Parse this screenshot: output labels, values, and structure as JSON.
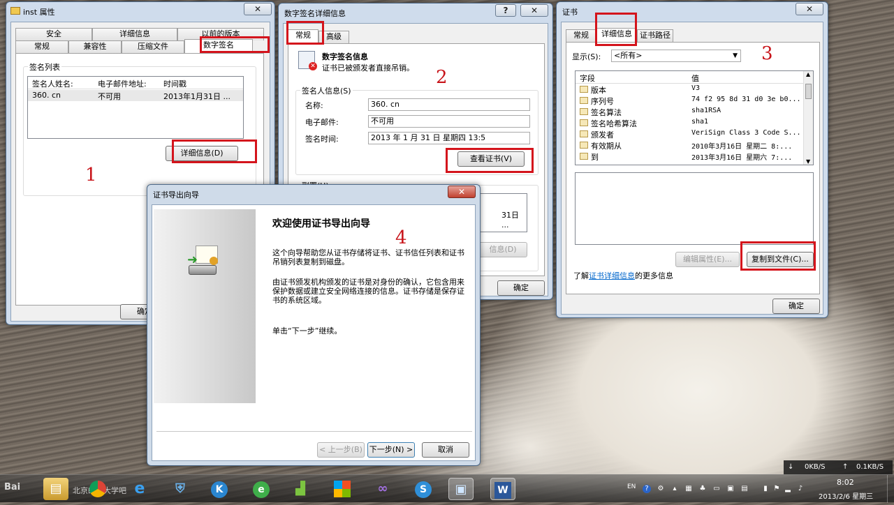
{
  "win1": {
    "title": "inst 属性",
    "close": "✕",
    "tabs_top": [
      "安全",
      "详细信息",
      "以前的版本"
    ],
    "tabs_bottom": [
      "常规",
      "兼容性",
      "压缩文件",
      "数字签名"
    ],
    "sig_list_label": "签名列表",
    "columns": [
      "签名人姓名:",
      "电子邮件地址:",
      "时间戳"
    ],
    "row": [
      "360. cn",
      "不可用",
      "2013年1月31日 ..."
    ],
    "details_button": "详细信息(D)",
    "ok_button": "确定"
  },
  "win2": {
    "title": "数字签名详细信息",
    "help": "?",
    "close": "✕",
    "tabs": [
      "常规",
      "高级"
    ],
    "info_title": "数字签名信息",
    "info_sub": "证书已被颁发者直接吊销。",
    "signer_group": "签名人信息(S)",
    "name_label": "名称:",
    "name_value": "360. cn",
    "email_label": "电子邮件:",
    "email_value": "不可用",
    "time_label": "签名时间:",
    "time_value": "2013  年  1  月  31  日   星期四 13:5",
    "view_cert_button": "查看证书(V)",
    "countersig_label": "副署(U)",
    "countersig_partial": "31日 ...",
    "countersig_details": "信息(D)",
    "ok_button": "确定"
  },
  "win3": {
    "title": "证书",
    "close": "✕",
    "tabs": [
      "常规",
      "详细信息",
      "证书路径"
    ],
    "show_label": "显示(S):",
    "show_value": "<所有>",
    "col_field": "字段",
    "col_value": "值",
    "rows": [
      {
        "field": "版本",
        "value": "V3"
      },
      {
        "field": "序列号",
        "value": "74 f2 95 8d 31 d0 3e b0..."
      },
      {
        "field": "签名算法",
        "value": "sha1RSA"
      },
      {
        "field": "签名哈希算法",
        "value": "sha1"
      },
      {
        "field": "颁发者",
        "value": "VeriSign Class 3 Code S..."
      },
      {
        "field": "有效期从",
        "value": "2010年3月16日 星期二 8:..."
      },
      {
        "field": "到",
        "value": "2013年3月16日 星期六 7:..."
      }
    ],
    "edit_props_button": "编辑属性(E)...",
    "copy_to_file_button": "复制到文件(C)...",
    "learn_more_prefix": "了解",
    "learn_more_link": "证书详细信息",
    "learn_more_suffix": "的更多信息",
    "ok_button": "确定"
  },
  "wizard": {
    "title": "证书导出向导",
    "close": "✕",
    "heading": "欢迎使用证书导出向导",
    "para1": "这个向导帮助您从证书存储将证书、证书信任列表和证书吊销列表复制到磁盘。",
    "para2": "由证书颁发机构颁发的证书是对身份的确认，它包含用来保护数据或建立安全网络连接的信息。证书存储是保存证书的系统区域。",
    "para3": "单击“下一步”继续。",
    "back_button": "< 上一步(B)",
    "next_button": "下一步(N) >",
    "cancel_button": "取消"
  },
  "annotations": [
    "1",
    "2",
    "3",
    "4"
  ],
  "taskbar": {
    "watermark": "Bai",
    "watermark2": "北京邮电大学吧",
    "lang": "EN",
    "time": "8:02",
    "date": "2013/2/6 星期三",
    "net_down": "0KB/S",
    "net_up": "0.1KB/S",
    "apps": [
      "explorer",
      "chrome",
      "ie",
      "security",
      "kugou",
      "browser",
      "chart",
      "office",
      "visual-studio",
      "sogou",
      "remote-desktop",
      "word"
    ]
  },
  "colors": {
    "annotation_red": "#d4141c",
    "link_blue": "#0066cc"
  }
}
